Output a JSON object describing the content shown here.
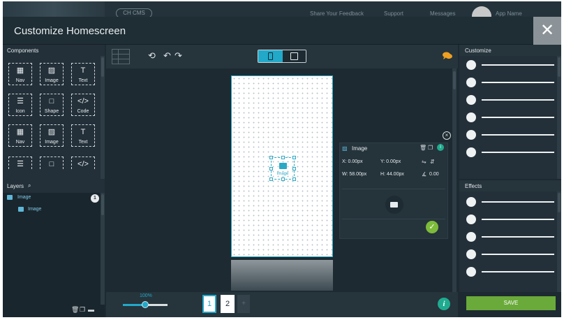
{
  "background": {
    "cms_pill": "CH CMS",
    "feedback": "Share Your Feedback",
    "support": "Support",
    "messages": "Messages",
    "user_name": "App Name"
  },
  "modal": {
    "title": "Customize Homescreen",
    "close_glyph": "✕"
  },
  "components": {
    "title": "Components",
    "tiles": [
      {
        "label": "Nav",
        "icon": "nav-icon",
        "glyph": "▦"
      },
      {
        "label": "Image",
        "icon": "image-icon",
        "glyph": "▨"
      },
      {
        "label": "Text",
        "icon": "text-icon",
        "glyph": "T"
      },
      {
        "label": "Icon",
        "icon": "list-icon",
        "glyph": "☰"
      },
      {
        "label": "Shape",
        "icon": "shape-icon",
        "glyph": "□"
      },
      {
        "label": "Code",
        "icon": "code-icon",
        "glyph": "</>"
      },
      {
        "label": "Nav",
        "icon": "nav-icon",
        "glyph": "▦"
      },
      {
        "label": "Image",
        "icon": "image-icon",
        "glyph": "▨"
      },
      {
        "label": "Text",
        "icon": "text-icon",
        "glyph": "T"
      },
      {
        "label": "",
        "icon": "list-icon",
        "glyph": "☰"
      },
      {
        "label": "",
        "icon": "shape-icon",
        "glyph": "□"
      },
      {
        "label": "",
        "icon": "code-icon",
        "glyph": "</>"
      }
    ]
  },
  "layers": {
    "title": "Layers",
    "count": "1",
    "items": [
      {
        "label": "Image",
        "icon": "layer-image-icon"
      },
      {
        "label": "Image",
        "icon": "layer-image-icon"
      }
    ]
  },
  "toolbar": {
    "history_glyph": "⟲",
    "undo_glyph": "↶",
    "redo_glyph": "↷",
    "device_selected": "mobile"
  },
  "canvas": {
    "element_label": "Image"
  },
  "properties": {
    "title": "Image",
    "x": "X: 0.00px",
    "y": "Y: 0.00px",
    "w": "W: 58.00px",
    "h": "H: 44.00px",
    "rotation": "0.00",
    "close_glyph": "×",
    "ok_glyph": "✓"
  },
  "footer": {
    "zoom": "100%",
    "zoom_fraction": 0.5,
    "pages": [
      "1",
      "2"
    ],
    "add_page": "+",
    "selected_page": "1",
    "info_glyph": "i"
  },
  "customize": {
    "title": "Customize",
    "slider_count": 6
  },
  "effects": {
    "title": "Effects",
    "slider_count": 5
  },
  "save_label": "SAVE",
  "colors": {
    "accent": "#22a9c9",
    "save": "#6aaa3a",
    "ok": "#7dbb3a",
    "info": "#1fab8f",
    "chat": "#f0a020"
  }
}
